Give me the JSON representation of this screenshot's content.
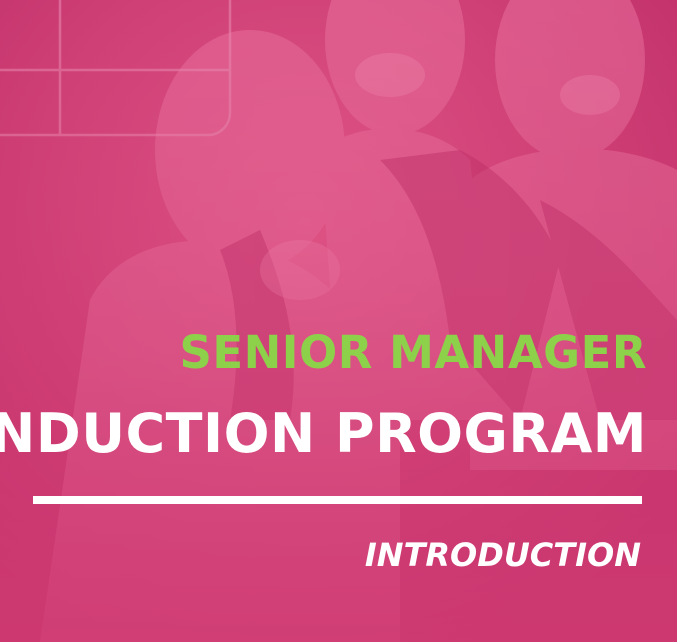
{
  "cover": {
    "title_line1": "SENIOR MANAGER",
    "title_line2": "INDUCTION PROGRAM",
    "subtitle": "INTRODUCTION"
  },
  "colors": {
    "background": "#cf3a72",
    "title_accent": "#8dd14b",
    "text": "#ffffff"
  }
}
